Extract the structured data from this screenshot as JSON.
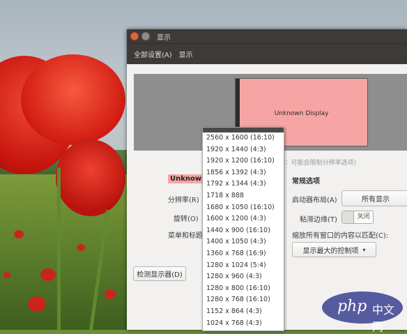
{
  "window": {
    "title": "显示",
    "toolbar": {
      "all_settings": "全部设置(A)",
      "current": "显示"
    }
  },
  "preview": {
    "monitor_label": "Unknown Display"
  },
  "hint": "(屏：可能会限制分辨率选项)",
  "left_panel": {
    "display_name": "Unknown D",
    "resolution_label": "分辨率(R)",
    "rotation_label": "旋转(O)",
    "menu_title_label": "菜单和标题"
  },
  "right_panel": {
    "section_title": "常规选项",
    "launcher_label": "启动器布局(A)",
    "launcher_value": "所有显示",
    "snap_label": "粘滞边缘(T)",
    "snap_value": "关闭",
    "scale_label": "缩放所有窗口的内容以匹配(C):",
    "scale_value": "显示最大的控制项"
  },
  "detect_button": "检测显示器(D)",
  "resolutions": [
    "2560 x 1600 (16:10)",
    "1920 x 1440 (4:3)",
    "1920 x 1200 (16:10)",
    "1856 x 1392 (4:3)",
    "1792 x 1344 (4:3)",
    "1718 x 888",
    "1680 x 1050 (16:10)",
    "1600 x 1200 (4:3)",
    "1440 x 900 (16:10)",
    "1400 x 1050 (4:3)",
    "1360 x 768 (16:9)",
    "1280 x 1024 (5:4)",
    "1280 x 960 (4:3)",
    "1280 x 800 (16:10)",
    "1280 x 768 (16:10)",
    "1152 x 864 (4:3)",
    "1024 x 768 (4:3)"
  ],
  "watermark": {
    "text": "php",
    "suffix": "中文网"
  },
  "colors": {
    "titlebar": "#3c3b37",
    "monitor": "#f6a5a4",
    "close_button": "#e3643d"
  }
}
